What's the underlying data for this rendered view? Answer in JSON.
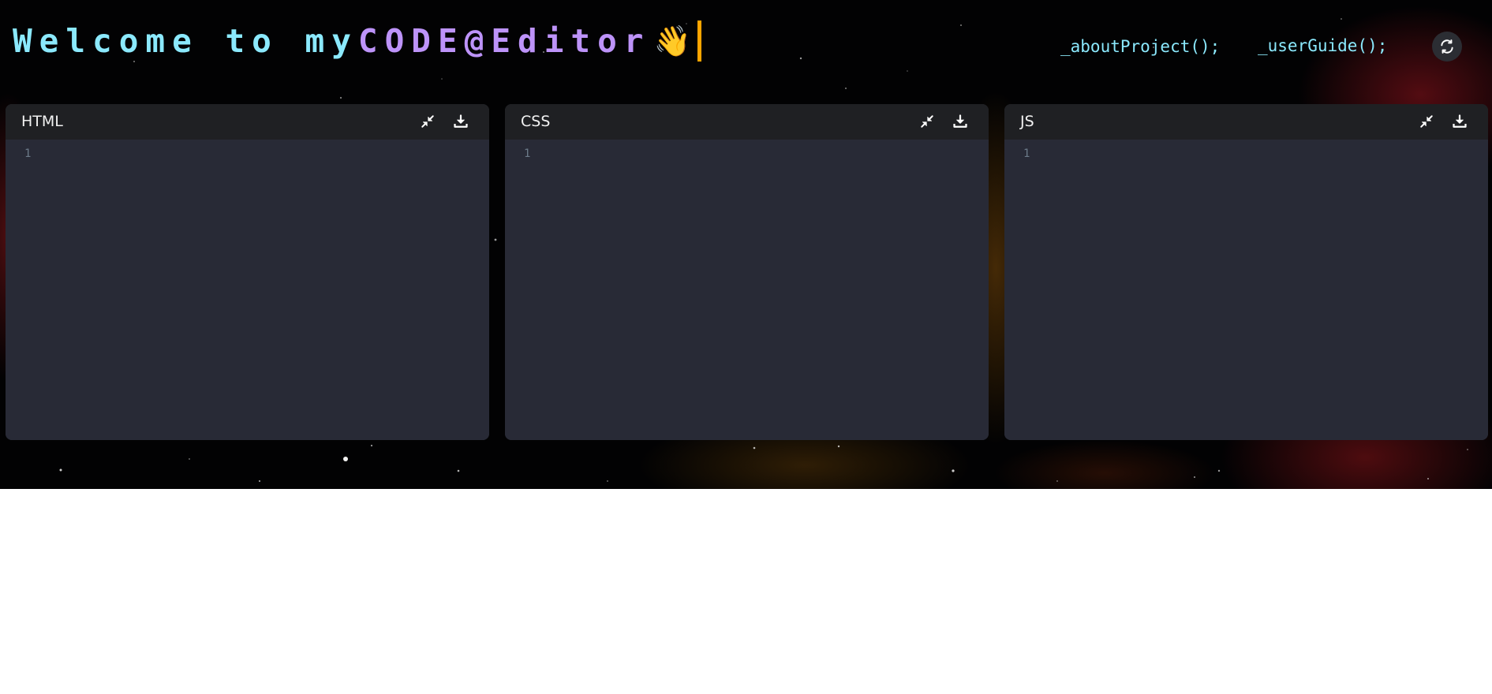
{
  "header": {
    "welcome_prefix": "Welcome to my ",
    "welcome_brand": "CODE@Editor",
    "wave_emoji": "👋",
    "colors": {
      "prefix": "#8be9fd",
      "brand": "#bd93f9",
      "caret": "#ffa500"
    }
  },
  "nav": {
    "about_label": "_aboutProject();",
    "guide_label": "_userGuide();",
    "reset_icon": "refresh-icon"
  },
  "editors": [
    {
      "title": "HTML",
      "line_number": "1",
      "minimize_icon": "minimize-icon",
      "download_icon": "download-icon"
    },
    {
      "title": "CSS",
      "line_number": "1",
      "minimize_icon": "minimize-icon",
      "download_icon": "download-icon"
    },
    {
      "title": "JS",
      "line_number": "1",
      "minimize_icon": "minimize-icon",
      "download_icon": "download-icon"
    }
  ],
  "theme": {
    "editor_bg": "#282a36",
    "header_bg": "#1f2023",
    "accent": "#8be9fd"
  }
}
